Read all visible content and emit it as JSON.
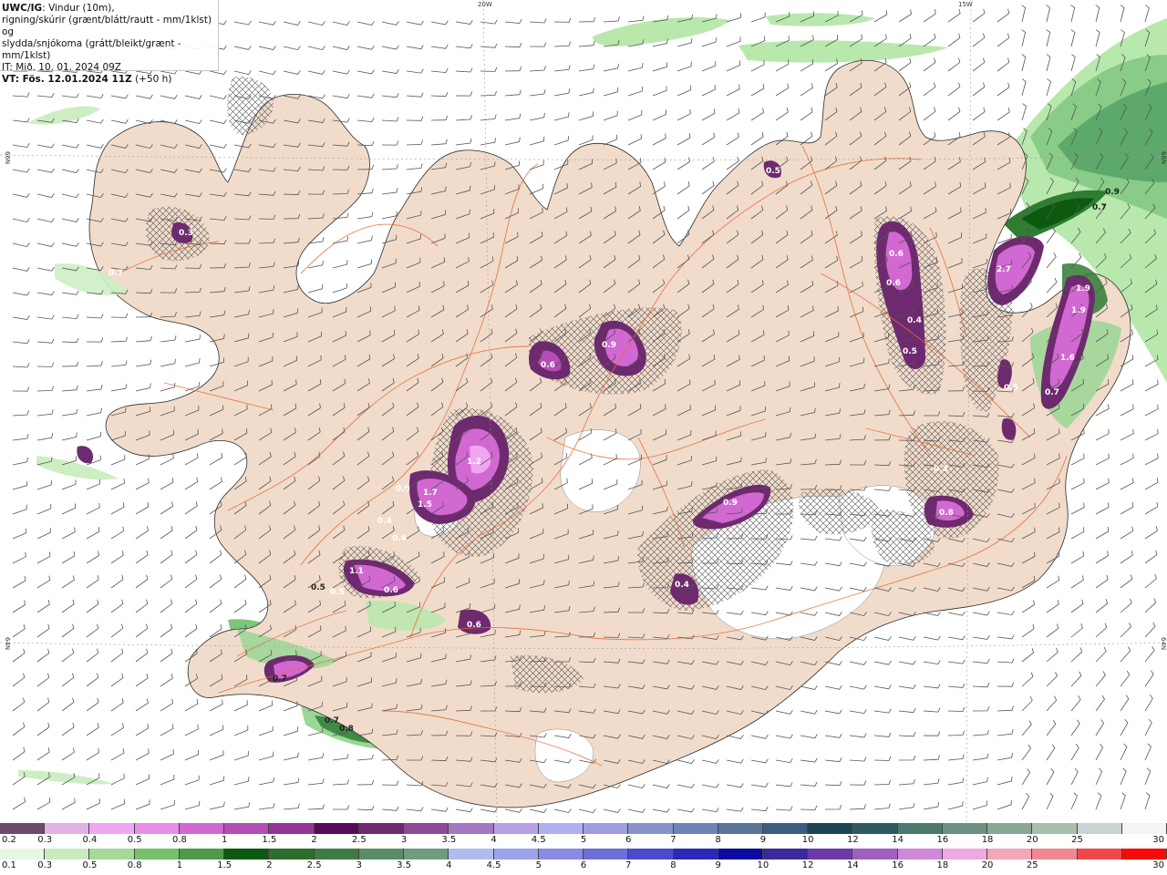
{
  "info": {
    "model": "UWC/IG",
    "line1": ": Vindur (10m),",
    "line2": "rigning/skúrir (grænt/blátt/rautt - mm/1klst) og",
    "line3": "slydda/snjókoma (grátt/bleikt/grænt - mm/1klst)",
    "it_line": "IT: Mið. 10. 01. 2024 09Z",
    "vt_line": "VT: Fös. 12.01.2024 11Z",
    "vt_offset": " (+50 h)"
  },
  "grid_labels": {
    "lon_20w": "20W",
    "lon_15w": "15W",
    "lat_66n_left": "66N",
    "lat_66n_right": "66N",
    "lat_64n_left": "64N",
    "lat_64n_right": "64N"
  },
  "legend_top": {
    "description": "snow/sleet scale (mm/1klst)",
    "colors": [
      "#6b4a6b",
      "#e3b1e3",
      "#f0a6f0",
      "#e88de8",
      "#d268d2",
      "#b64cb6",
      "#943494",
      "#5a0a5a",
      "#6e2a6e",
      "#8a4a96",
      "#a577c0",
      "#b8a0e6",
      "#aeb2f0",
      "#9e9ee0",
      "#8a92cc",
      "#6f84b6",
      "#5a749a",
      "#3b5e7e",
      "#1d4654",
      "#2e5c5e",
      "#4a7a6e",
      "#6a9280",
      "#88a894",
      "#a8bea8",
      "#c8d4d4",
      "#f4f4f4"
    ],
    "labels": [
      "0.2",
      "0.3",
      "0.4",
      "0.5",
      "0.8",
      "1",
      "1.5",
      "2",
      "2.5",
      "3",
      "3.5",
      "4",
      "4.5",
      "5",
      "6",
      "7",
      "8",
      "9",
      "10",
      "12",
      "14",
      "16",
      "18",
      "20",
      "25",
      "30"
    ]
  },
  "legend_bottom": {
    "description": "rain/showers scale (mm/1klst)",
    "colors": [
      "#e9f7e3",
      "#c9ebbd",
      "#a4d998",
      "#78c06c",
      "#4e9a48",
      "#0c5a10",
      "#2c6e2c",
      "#3f7c44",
      "#5a8c66",
      "#6e9c7e",
      "#aebcee",
      "#9ca2ec",
      "#8a8ae4",
      "#6e6ed8",
      "#4a4acc",
      "#2a2ab8",
      "#0a0aa0",
      "#3a2a9a",
      "#6a3aa8",
      "#a060c0",
      "#d088d8",
      "#f0a8e0",
      "#f2a8b8",
      "#f08890",
      "#f04848",
      "#f80808"
    ],
    "labels": [
      "0.1",
      "0.3",
      "0.5",
      "0.8",
      "1",
      "1.5",
      "2",
      "2.5",
      "3",
      "3.5",
      "4",
      "4.5",
      "5",
      "6",
      "7",
      "8",
      "9",
      "10",
      "12",
      "14",
      "16",
      "18",
      "20",
      "25",
      "30"
    ]
  },
  "field_labels": [
    {
      "text": "0.3",
      "color": "#ffffff"
    },
    {
      "text": "0.7",
      "color": "#ffffff"
    },
    {
      "text": "0.5",
      "color": "#ffffff"
    },
    {
      "text": "0.6",
      "color": "#ffffff"
    },
    {
      "text": "0.9",
      "color": "#ffffff"
    },
    {
      "text": "0.6",
      "color": "#ffffff"
    },
    {
      "text": "0.6",
      "color": "#ffffff"
    },
    {
      "text": "0.4",
      "color": "#ffffff"
    },
    {
      "text": "0.5",
      "color": "#ffffff"
    },
    {
      "text": "0.4",
      "color": "#ffffff"
    },
    {
      "text": "1.2",
      "color": "#ffffff"
    },
    {
      "text": "0.9",
      "color": "#ffffff"
    },
    {
      "text": "1.7",
      "color": "#ffffff"
    },
    {
      "text": "1.5",
      "color": "#ffffff"
    },
    {
      "text": "0.4",
      "color": "#ffffff"
    },
    {
      "text": "1.1",
      "color": "#ffffff"
    },
    {
      "text": "0.6",
      "color": "#ffffff"
    },
    {
      "text": "0.5",
      "color": "#222222"
    },
    {
      "text": "0.5",
      "color": "#ffffff"
    },
    {
      "text": "0.6",
      "color": "#ffffff"
    },
    {
      "text": "0.9",
      "color": "#ffffff"
    },
    {
      "text": "0.4",
      "color": "#ffffff"
    },
    {
      "text": "0.3",
      "color": "#ffffff"
    },
    {
      "text": "2.7",
      "color": "#ffffff"
    },
    {
      "text": "1.9",
      "color": "#ffffff"
    },
    {
      "text": "1.9",
      "color": "#ffffff"
    },
    {
      "text": "1.6",
      "color": "#ffffff"
    },
    {
      "text": "0.8",
      "color": "#ffffff"
    },
    {
      "text": "0.5",
      "color": "#ffffff"
    },
    {
      "text": "0.7",
      "color": "#ffffff"
    },
    {
      "text": "0.7",
      "color": "#222222"
    },
    {
      "text": "0.7",
      "color": "#222222"
    },
    {
      "text": "0.8",
      "color": "#222222"
    },
    {
      "text": "0.9",
      "color": "#222222"
    },
    {
      "text": "0.7",
      "color": "#222222"
    }
  ]
}
